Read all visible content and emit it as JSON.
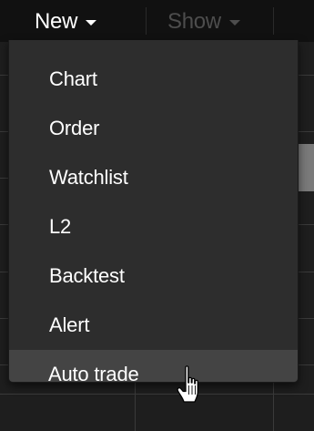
{
  "menubar": {
    "new_label": "New",
    "show_label": "Show"
  },
  "dropdown": {
    "items": [
      {
        "label": "Chart"
      },
      {
        "label": "Order"
      },
      {
        "label": "Watchlist"
      },
      {
        "label": "L2"
      },
      {
        "label": "Backtest"
      },
      {
        "label": "Alert"
      },
      {
        "label": "Auto trade",
        "hovered": true
      }
    ]
  },
  "cursor": {
    "icon": "hand-pointer-icon"
  }
}
